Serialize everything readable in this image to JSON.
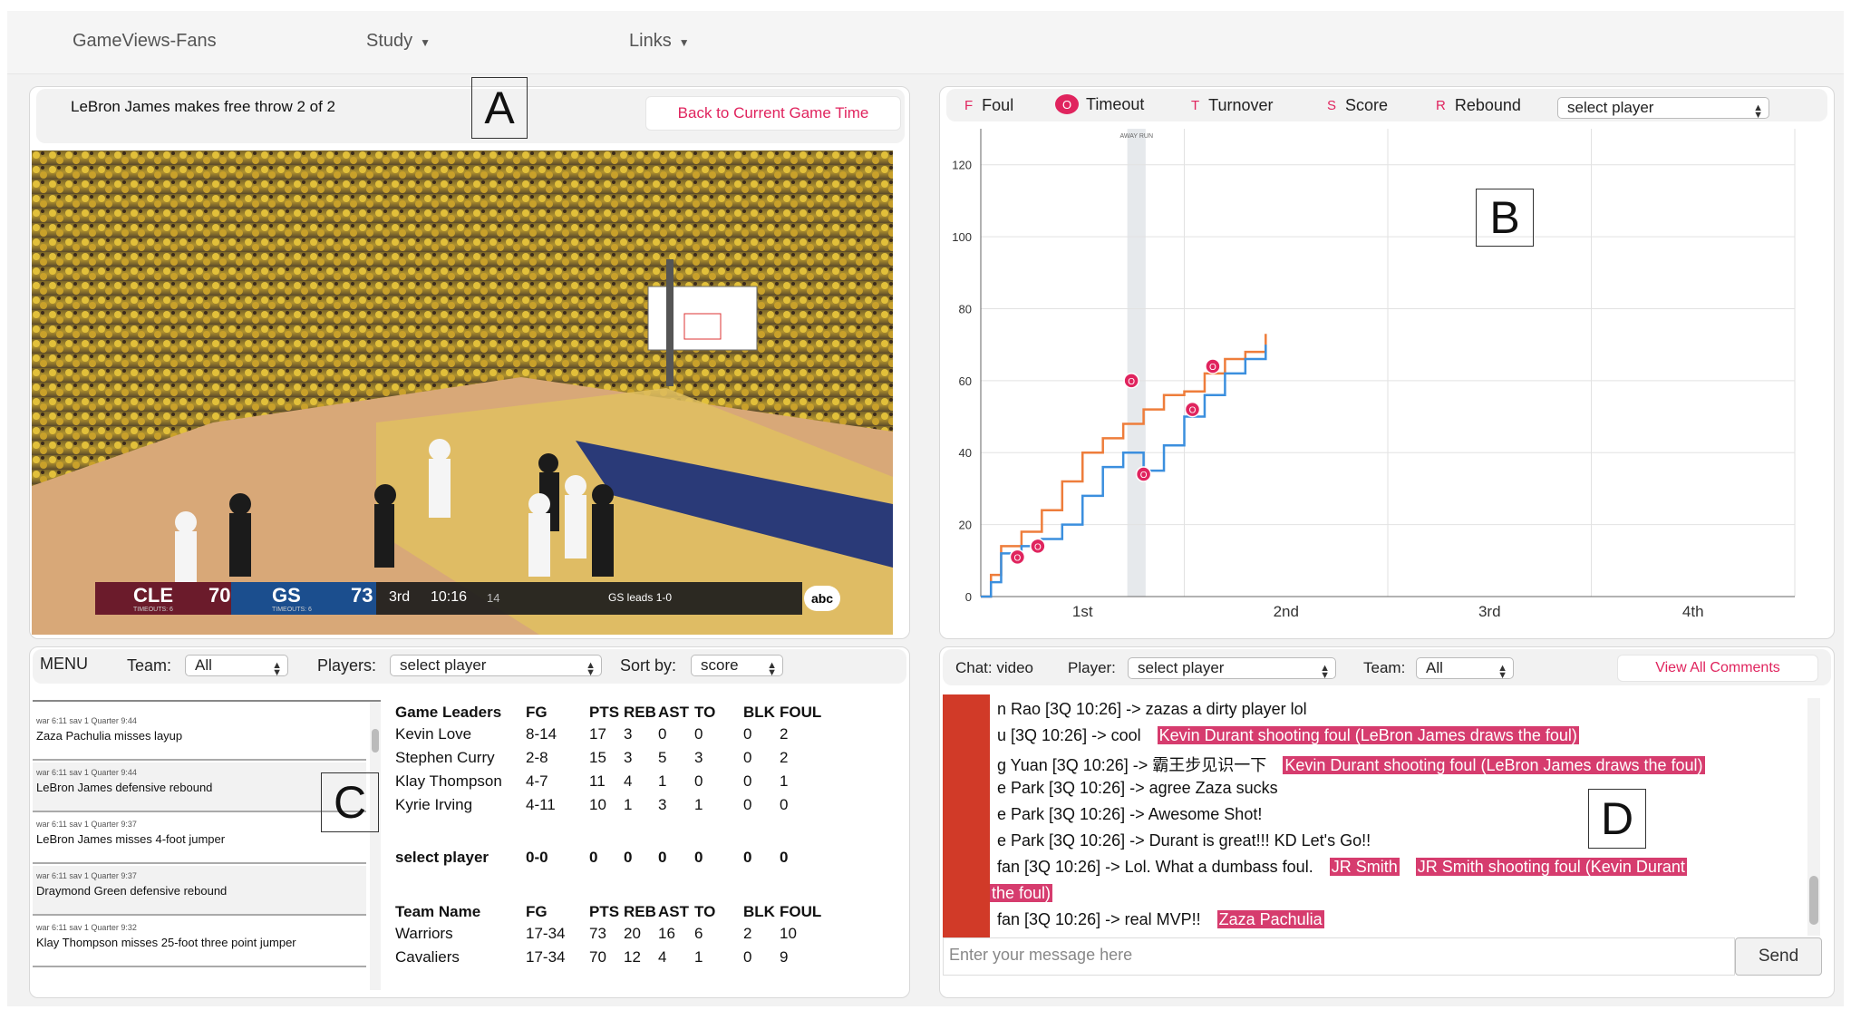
{
  "nav": {
    "brand": "GameViews-Fans",
    "study": "Study",
    "links": "Links"
  },
  "panelA": {
    "event_text": "LeBron James makes free throw 2 of 2",
    "back_button": "Back to Current Game Time",
    "label": "A"
  },
  "scoreboard": {
    "away_team": "CLE",
    "away_score": "70",
    "home_team": "GS",
    "home_score": "73",
    "quarter": "3rd",
    "clock": "10:16",
    "shot_clock": "14",
    "series": "GS leads 1-0",
    "away_timeouts": "TIMEOUTS: 6",
    "home_timeouts": "TIMEOUTS: 6",
    "network": "abc"
  },
  "panelB": {
    "label": "B",
    "legend": [
      {
        "key": "F",
        "label": "Foul"
      },
      {
        "key": "O",
        "label": "Timeout"
      },
      {
        "key": "T",
        "label": "Turnover"
      },
      {
        "key": "S",
        "label": "Score"
      },
      {
        "key": "R",
        "label": "Rebound"
      }
    ],
    "player_select": "select player",
    "shaded_label": "AWAY RUN"
  },
  "chart_data": {
    "type": "line",
    "x_categories": [
      "1st",
      "2nd",
      "3rd",
      "4th"
    ],
    "yticks": [
      "0",
      "20",
      "40",
      "60",
      "80",
      "100",
      "120"
    ],
    "ylim": [
      0,
      130
    ],
    "grid": true,
    "series": [
      {
        "color": "#ee7d3b",
        "points": [
          [
            0,
            0
          ],
          [
            0.05,
            6
          ],
          [
            0.1,
            14
          ],
          [
            0.2,
            18
          ],
          [
            0.3,
            24
          ],
          [
            0.4,
            32
          ],
          [
            0.5,
            40
          ],
          [
            0.6,
            44
          ],
          [
            0.7,
            48
          ],
          [
            0.8,
            52
          ],
          [
            0.9,
            56
          ],
          [
            1.0,
            57
          ],
          [
            1.1,
            62
          ],
          [
            1.2,
            66
          ],
          [
            1.3,
            68
          ],
          [
            1.4,
            73
          ]
        ]
      },
      {
        "color": "#3b8fde",
        "points": [
          [
            0,
            0
          ],
          [
            0.05,
            4
          ],
          [
            0.1,
            12
          ],
          [
            0.2,
            14
          ],
          [
            0.3,
            16
          ],
          [
            0.4,
            20
          ],
          [
            0.5,
            28
          ],
          [
            0.6,
            36
          ],
          [
            0.7,
            40
          ],
          [
            0.8,
            35
          ],
          [
            0.9,
            42
          ],
          [
            1.0,
            50
          ],
          [
            1.1,
            56
          ],
          [
            1.2,
            62
          ],
          [
            1.3,
            66
          ],
          [
            1.4,
            70
          ]
        ]
      }
    ],
    "timeouts": [
      [
        0.18,
        11
      ],
      [
        0.28,
        14
      ],
      [
        0.74,
        60
      ],
      [
        0.8,
        34
      ],
      [
        1.04,
        52
      ],
      [
        1.14,
        64
      ]
    ],
    "shaded_range": [
      0.72,
      0.81
    ]
  },
  "panelC": {
    "label": "C",
    "menu": "MENU",
    "team_label": "Team:",
    "team_value": "All",
    "players_label": "Players:",
    "players_value": "select player",
    "sort_label": "Sort by:",
    "sort_value": "score",
    "plays": [
      {
        "time": "war 6:11 sav 1 Quarter 9:44",
        "desc": "Zaza Pachulia misses layup"
      },
      {
        "time": "war 6:11 sav 1 Quarter 9:44",
        "desc": "LeBron James defensive rebound"
      },
      {
        "time": "war 6:11 sav 1 Quarter 9:37",
        "desc": "LeBron James misses 4-foot jumper"
      },
      {
        "time": "war 6:11 sav 1 Quarter 9:37",
        "desc": "Draymond Green defensive rebound"
      },
      {
        "time": "war 6:11 sav 1 Quarter 9:32",
        "desc": "Klay Thompson misses 25-foot three point jumper"
      }
    ],
    "leaders_header": [
      "Game Leaders",
      "FG",
      "PTS",
      "REB",
      "AST",
      "TO",
      "BLK",
      "FOUL"
    ],
    "leaders": [
      [
        "Kevin Love",
        "8-14",
        "17",
        "3",
        "0",
        "0",
        "0",
        "2"
      ],
      [
        "Stephen Curry",
        "2-8",
        "15",
        "3",
        "5",
        "3",
        "0",
        "2"
      ],
      [
        "Klay Thompson",
        "4-7",
        "11",
        "4",
        "1",
        "0",
        "0",
        "1"
      ],
      [
        "Kyrie Irving",
        "4-11",
        "10",
        "1",
        "3",
        "1",
        "0",
        "0"
      ]
    ],
    "selected": [
      "select player",
      "0-0",
      "0",
      "0",
      "0",
      "0",
      "0",
      "0"
    ],
    "team_header": [
      "Team Name",
      "FG",
      "PTS",
      "REB",
      "AST",
      "TO",
      "BLK",
      "FOUL"
    ],
    "teams": [
      [
        "Warriors",
        "17-34",
        "73",
        "20",
        "16",
        "6",
        "2",
        "10"
      ],
      [
        "Cavaliers",
        "17-34",
        "70",
        "12",
        "4",
        "1",
        "0",
        "9"
      ]
    ]
  },
  "panelD": {
    "label": "D",
    "chat_label": "Chat: video",
    "player_label": "Player:",
    "player_value": "select player",
    "team_label": "Team:",
    "team_value": "All",
    "view_all": "View All Comments",
    "input_placeholder": "Enter your message here",
    "send": "Send",
    "messages": [
      {
        "text": "n Rao  [3Q 10:26]   -> zazas a dirty player lol",
        "tags": []
      },
      {
        "text": "u  [3Q 10:26]   -> cool",
        "tags": [
          "Kevin Durant shooting foul (LeBron James draws the foul)"
        ]
      },
      {
        "text": "g Yuan  [3Q 10:26]   -> 霸王步见识一下",
        "tags": [
          "Kevin Durant shooting foul (LeBron James draws the foul)"
        ]
      },
      {
        "text": "e Park  [3Q 10:26]   -> agree Zaza sucks",
        "tags": []
      },
      {
        "text": "e Park  [3Q 10:26]   -> Awesome Shot!",
        "tags": []
      },
      {
        "text": "e Park  [3Q 10:26]   -> Durant is great!!! KD Let's Go!!",
        "tags": []
      },
      {
        "text": "fan  [3Q 10:26]   -> Lol. What a dumbass foul.",
        "tags": [
          "JR Smith",
          "JR Smith shooting foul (Kevin Durant"
        ]
      },
      {
        "text": "",
        "tags": [
          "the foul)"
        ]
      },
      {
        "text": "fan  [3Q 10:26]   -> real MVP!!",
        "tags": [
          "Zaza Pachulia"
        ]
      }
    ]
  }
}
